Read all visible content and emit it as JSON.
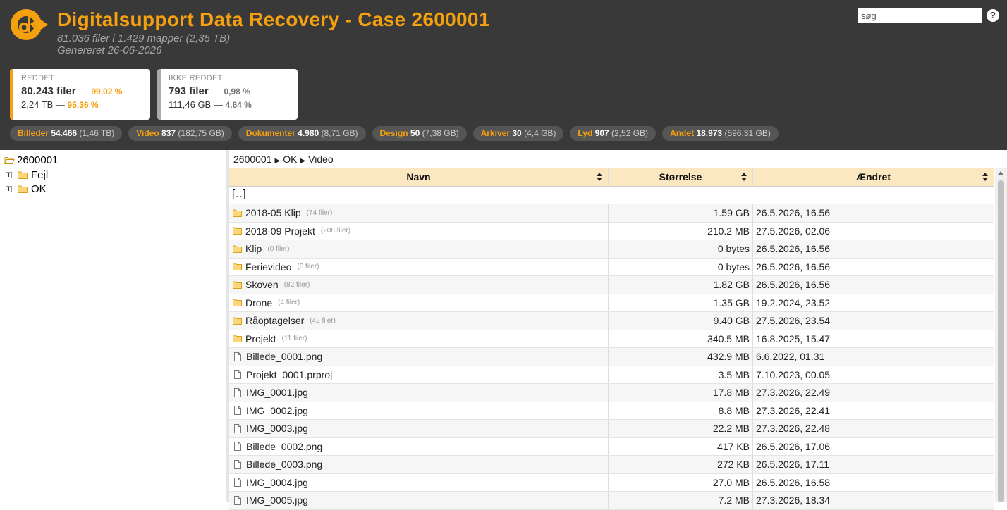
{
  "header": {
    "title": "Digitalsupport Data Recovery - Case 2600001",
    "subtitle": "81.036 filer i 1.429 mapper (2,35 TB)",
    "generated": "Genereret 26-06-2026",
    "search_placeholder": "søg",
    "help_label": "?",
    "brand_color": "#f5a00f",
    "background_color": "#393939"
  },
  "cards": {
    "saved": {
      "label": "REDDET",
      "files": "80.243 filer",
      "files_pct": "99,02 %",
      "size": "2,24 TB",
      "size_pct": "95,36 %"
    },
    "unsaved": {
      "label": "IKKE REDDET",
      "files": "793 filer",
      "files_pct": "0,98 %",
      "size": "111,46 GB",
      "size_pct": "4,64 %"
    },
    "separator": "—"
  },
  "categories": [
    {
      "name": "Billeder",
      "count": "54.466",
      "size": "(1,46 TB)"
    },
    {
      "name": "Video",
      "count": "837",
      "size": "(182,75 GB)"
    },
    {
      "name": "Dokumenter",
      "count": "4.980",
      "size": "(8,71 GB)"
    },
    {
      "name": "Design",
      "count": "50",
      "size": "(7,38 GB)"
    },
    {
      "name": "Arkiver",
      "count": "30",
      "size": "(4,4 GB)"
    },
    {
      "name": "Lyd",
      "count": "907",
      "size": "(2,52 GB)"
    },
    {
      "name": "Andet",
      "count": "18.973",
      "size": "(596,31 GB)"
    }
  ],
  "tree": {
    "root": "2600001",
    "children": [
      "Fejl",
      "OK"
    ]
  },
  "breadcrumb": [
    "2600001",
    "OK",
    "Video"
  ],
  "table": {
    "columns": [
      "Navn",
      "Størrelse",
      "Ændret"
    ],
    "parent_link": "[..]",
    "rows": [
      {
        "type": "folder",
        "name": "2018-05 Klip",
        "count": "(74 filer)",
        "size": "1.59 GB",
        "modified": "26.5.2026, 16.56"
      },
      {
        "type": "folder",
        "name": "2018-09 Projekt",
        "count": "(208 filer)",
        "size": "210.2 MB",
        "modified": "27.5.2026, 02.06"
      },
      {
        "type": "folder",
        "name": "Klip",
        "count": "(0 filer)",
        "size": "0 bytes",
        "modified": "26.5.2026, 16.56"
      },
      {
        "type": "folder",
        "name": "Ferievideo",
        "count": "(0 filer)",
        "size": "0 bytes",
        "modified": "26.5.2026, 16.56"
      },
      {
        "type": "folder",
        "name": "Skoven",
        "count": "(82 filer)",
        "size": "1.82 GB",
        "modified": "26.5.2026, 16.56"
      },
      {
        "type": "folder",
        "name": "Drone",
        "count": "(4 filer)",
        "size": "1.35 GB",
        "modified": "19.2.2024, 23.52"
      },
      {
        "type": "folder",
        "name": "Råoptagelser",
        "count": "(42 filer)",
        "size": "9.40 GB",
        "modified": "27.5.2026, 23.54"
      },
      {
        "type": "folder",
        "name": "Projekt",
        "count": "(11 filer)",
        "size": "340.5 MB",
        "modified": "16.8.2025, 15.47"
      },
      {
        "type": "file",
        "name": "Billede_0001.png",
        "count": "",
        "size": "432.9 MB",
        "modified": "6.6.2022, 01.31"
      },
      {
        "type": "file",
        "name": "Projekt_0001.prproj",
        "count": "",
        "size": "3.5 MB",
        "modified": "7.10.2023, 00.05"
      },
      {
        "type": "file",
        "name": "IMG_0001.jpg",
        "count": "",
        "size": "17.8 MB",
        "modified": "27.3.2026, 22.49"
      },
      {
        "type": "file",
        "name": "IMG_0002.jpg",
        "count": "",
        "size": "8.8 MB",
        "modified": "27.3.2026, 22.41"
      },
      {
        "type": "file",
        "name": "IMG_0003.jpg",
        "count": "",
        "size": "22.2 MB",
        "modified": "27.3.2026, 22.48"
      },
      {
        "type": "file",
        "name": "Billede_0002.png",
        "count": "",
        "size": "417 KB",
        "modified": "26.5.2026, 17.06"
      },
      {
        "type": "file",
        "name": "Billede_0003.png",
        "count": "",
        "size": "272 KB",
        "modified": "26.5.2026, 17.11"
      },
      {
        "type": "file",
        "name": "IMG_0004.jpg",
        "count": "",
        "size": "27.0 MB",
        "modified": "26.5.2026, 16.58"
      },
      {
        "type": "file",
        "name": "IMG_0005.jpg",
        "count": "",
        "size": "7.2 MB",
        "modified": "27.3.2026, 18.34"
      }
    ]
  },
  "icons": {
    "folder": "folder-icon",
    "file": "file-icon",
    "expand": "plus-expander-icon",
    "sort": "sort-arrows-icon"
  }
}
